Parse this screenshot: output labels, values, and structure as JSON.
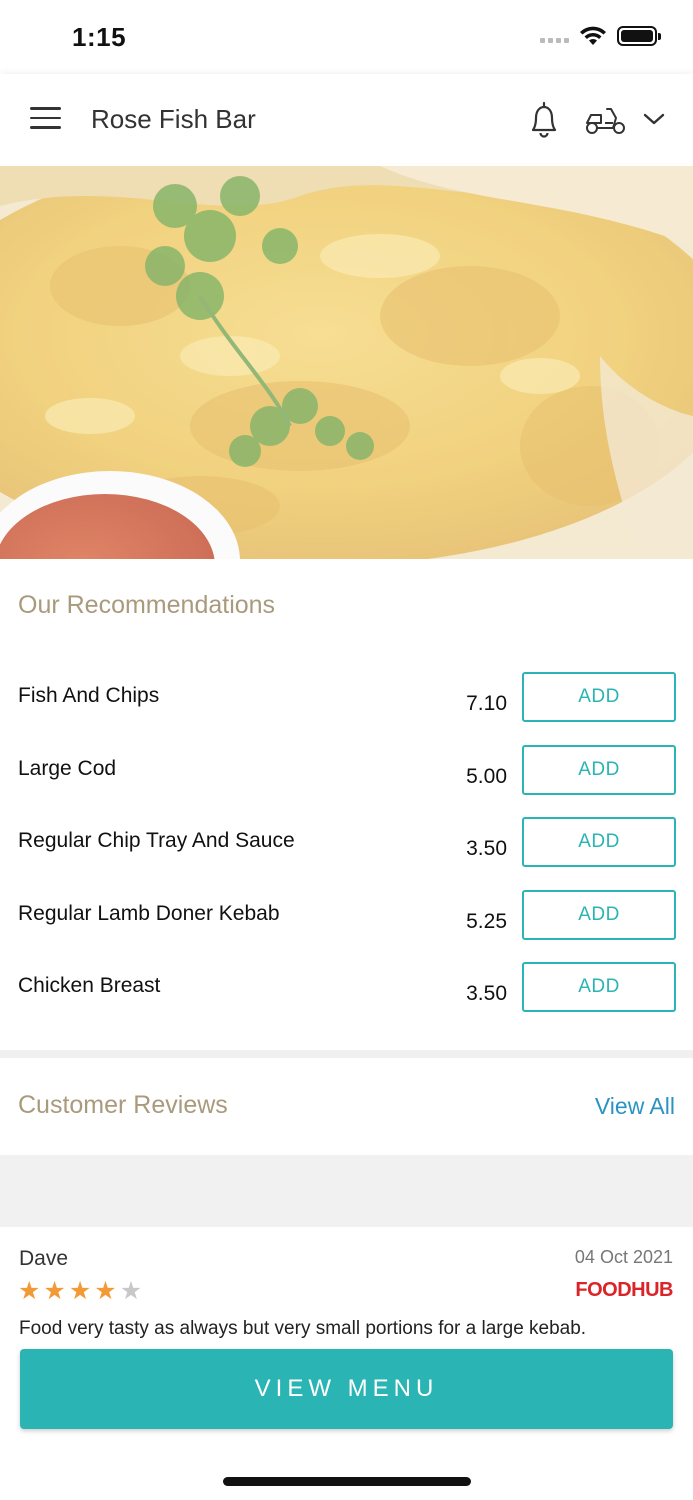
{
  "status_bar": {
    "time": "1:15"
  },
  "header": {
    "title": "Rose Fish Bar",
    "icons": [
      "menu-icon",
      "bell-icon",
      "scooter-icon",
      "chevron-down-icon"
    ]
  },
  "hero": {
    "image": "fried-fish-with-parsley-and-sauce"
  },
  "recommendations": {
    "title": "Our Recommendations",
    "items": [
      {
        "name": "Fish And Chips",
        "price": "7.10",
        "button": "ADD"
      },
      {
        "name": "Large Cod",
        "price": "5.00",
        "button": "ADD"
      },
      {
        "name": "Regular Chip Tray And Sauce",
        "price": "3.50",
        "button": "ADD"
      },
      {
        "name": "Regular Lamb Doner Kebab",
        "price": "5.25",
        "button": "ADD"
      },
      {
        "name": "Chicken Breast",
        "price": "3.50",
        "button": "ADD"
      }
    ]
  },
  "reviews": {
    "title": "Customer Reviews",
    "view_all": "View All",
    "items": [
      {
        "name": "Dave",
        "date": "04 Oct 2021",
        "rating": 4,
        "rating_max": 5,
        "source": "FOODHUB",
        "text": "Food very tasty as always but very small portions for a large kebab."
      }
    ]
  },
  "cta": {
    "label": "VIEW MENU"
  },
  "colors": {
    "accent": "#2ab4b3",
    "section_title": "#a99a7c",
    "link": "#2a93c4",
    "star": "#f29a35",
    "brand": "#d9252a"
  }
}
